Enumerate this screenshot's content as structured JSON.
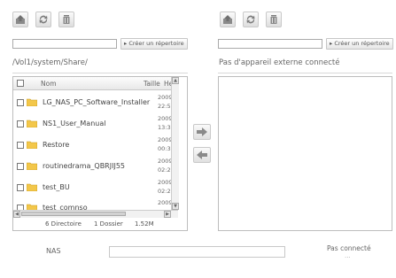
{
  "left": {
    "create_dir_label": "Créer un répertoire",
    "path_input_value": "",
    "current_path": "/Vol1/system/Share/",
    "columns": {
      "name": "Nom",
      "size": "Taille",
      "time": "Heu"
    },
    "rows": [
      {
        "name": "LG_NAS_PC_Software_Installer",
        "time1": "2009",
        "time2": "22:5"
      },
      {
        "name": "NS1_User_Manual",
        "time1": "2009",
        "time2": "13:3"
      },
      {
        "name": "Restore",
        "time1": "2009",
        "time2": "00:3"
      },
      {
        "name": "routinedrama_QBRJIJ55",
        "time1": "2009",
        "time2": "02:2"
      },
      {
        "name": "test_BU",
        "time1": "2009",
        "time2": "02:2"
      },
      {
        "name": "test_comnso",
        "time1": "2009",
        "time2": ""
      }
    ],
    "status": {
      "directories": "6 Directoire",
      "folders": "1 Dossier",
      "size": "1.52M"
    }
  },
  "right": {
    "create_dir_label": "Créer un répertoire",
    "path_input_value": "",
    "status_message": "Pas d'appareil externe connecté"
  },
  "footer": {
    "nas_label": "NAS",
    "nas_field_value": "",
    "connection_status": "Pas connecté",
    "connection_dots": "..."
  },
  "icons": {
    "toolbar": [
      "upload-icon",
      "refresh-icon",
      "delete-icon"
    ],
    "transfer": [
      "arrow-right-icon",
      "arrow-left-icon"
    ]
  },
  "colors": {
    "folder": "#f3c74a",
    "icon_gray": "#8a8a8a"
  }
}
